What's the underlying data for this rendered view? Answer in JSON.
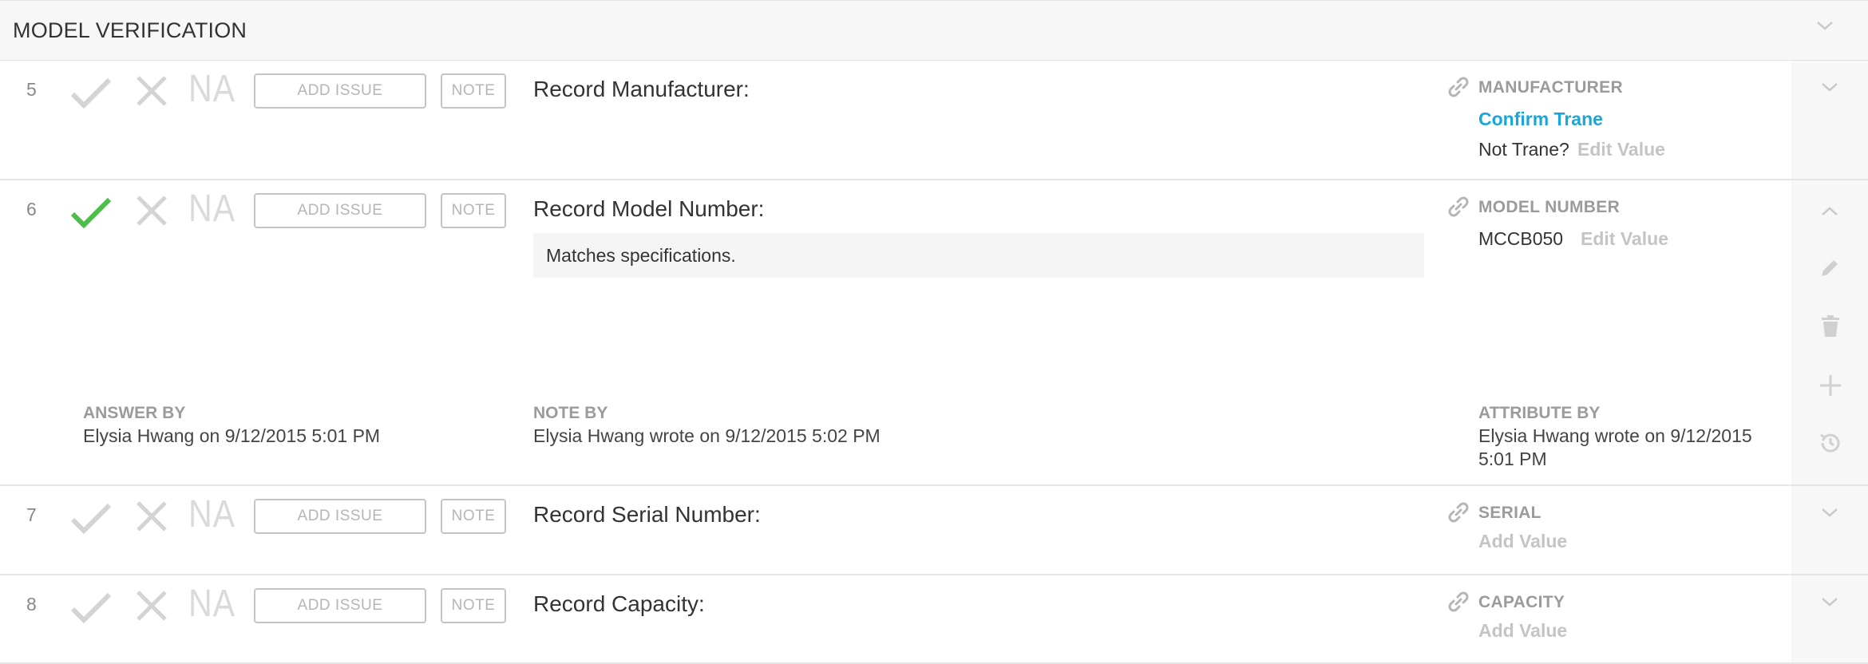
{
  "section": {
    "title": "MODEL VERIFICATION"
  },
  "buttons": {
    "na": "NA",
    "add_issue": "ADD ISSUE",
    "note": "NOTE"
  },
  "rows": [
    {
      "number": "5",
      "question": "Record Manufacturer:",
      "attribute_label": "MANUFACTURER",
      "confirm_link": "Confirm Trane",
      "not_prompt": "Not Trane?",
      "edit_value": "Edit Value",
      "checked": false
    },
    {
      "number": "6",
      "question": "Record Model Number:",
      "attribute_label": "MODEL NUMBER",
      "value": "MCCB050",
      "edit_value": "Edit Value",
      "note": "Matches specifications.",
      "checked": true,
      "answer_by_label": "ANSWER BY",
      "answer_by": "Elysia Hwang on 9/12/2015 5:01 PM",
      "note_by_label": "NOTE BY",
      "note_by": "Elysia Hwang wrote on 9/12/2015 5:02 PM",
      "attribute_by_label": "ATTRIBUTE BY",
      "attribute_by_line1": "Elysia Hwang wrote on 9/12/2015",
      "attribute_by_line2": "5:01 PM"
    },
    {
      "number": "7",
      "question": "Record Serial Number:",
      "attribute_label": "SERIAL",
      "add_value": "Add Value",
      "checked": false
    },
    {
      "number": "8",
      "question": "Record Capacity:",
      "attribute_label": "CAPACITY",
      "add_value": "Add Value",
      "checked": false
    }
  ],
  "colors": {
    "check_active": "#4cbe4a",
    "icon_inactive": "#d4d4d4",
    "link_blue": "#1ba6d8",
    "muted_label": "#9b9b9b"
  }
}
